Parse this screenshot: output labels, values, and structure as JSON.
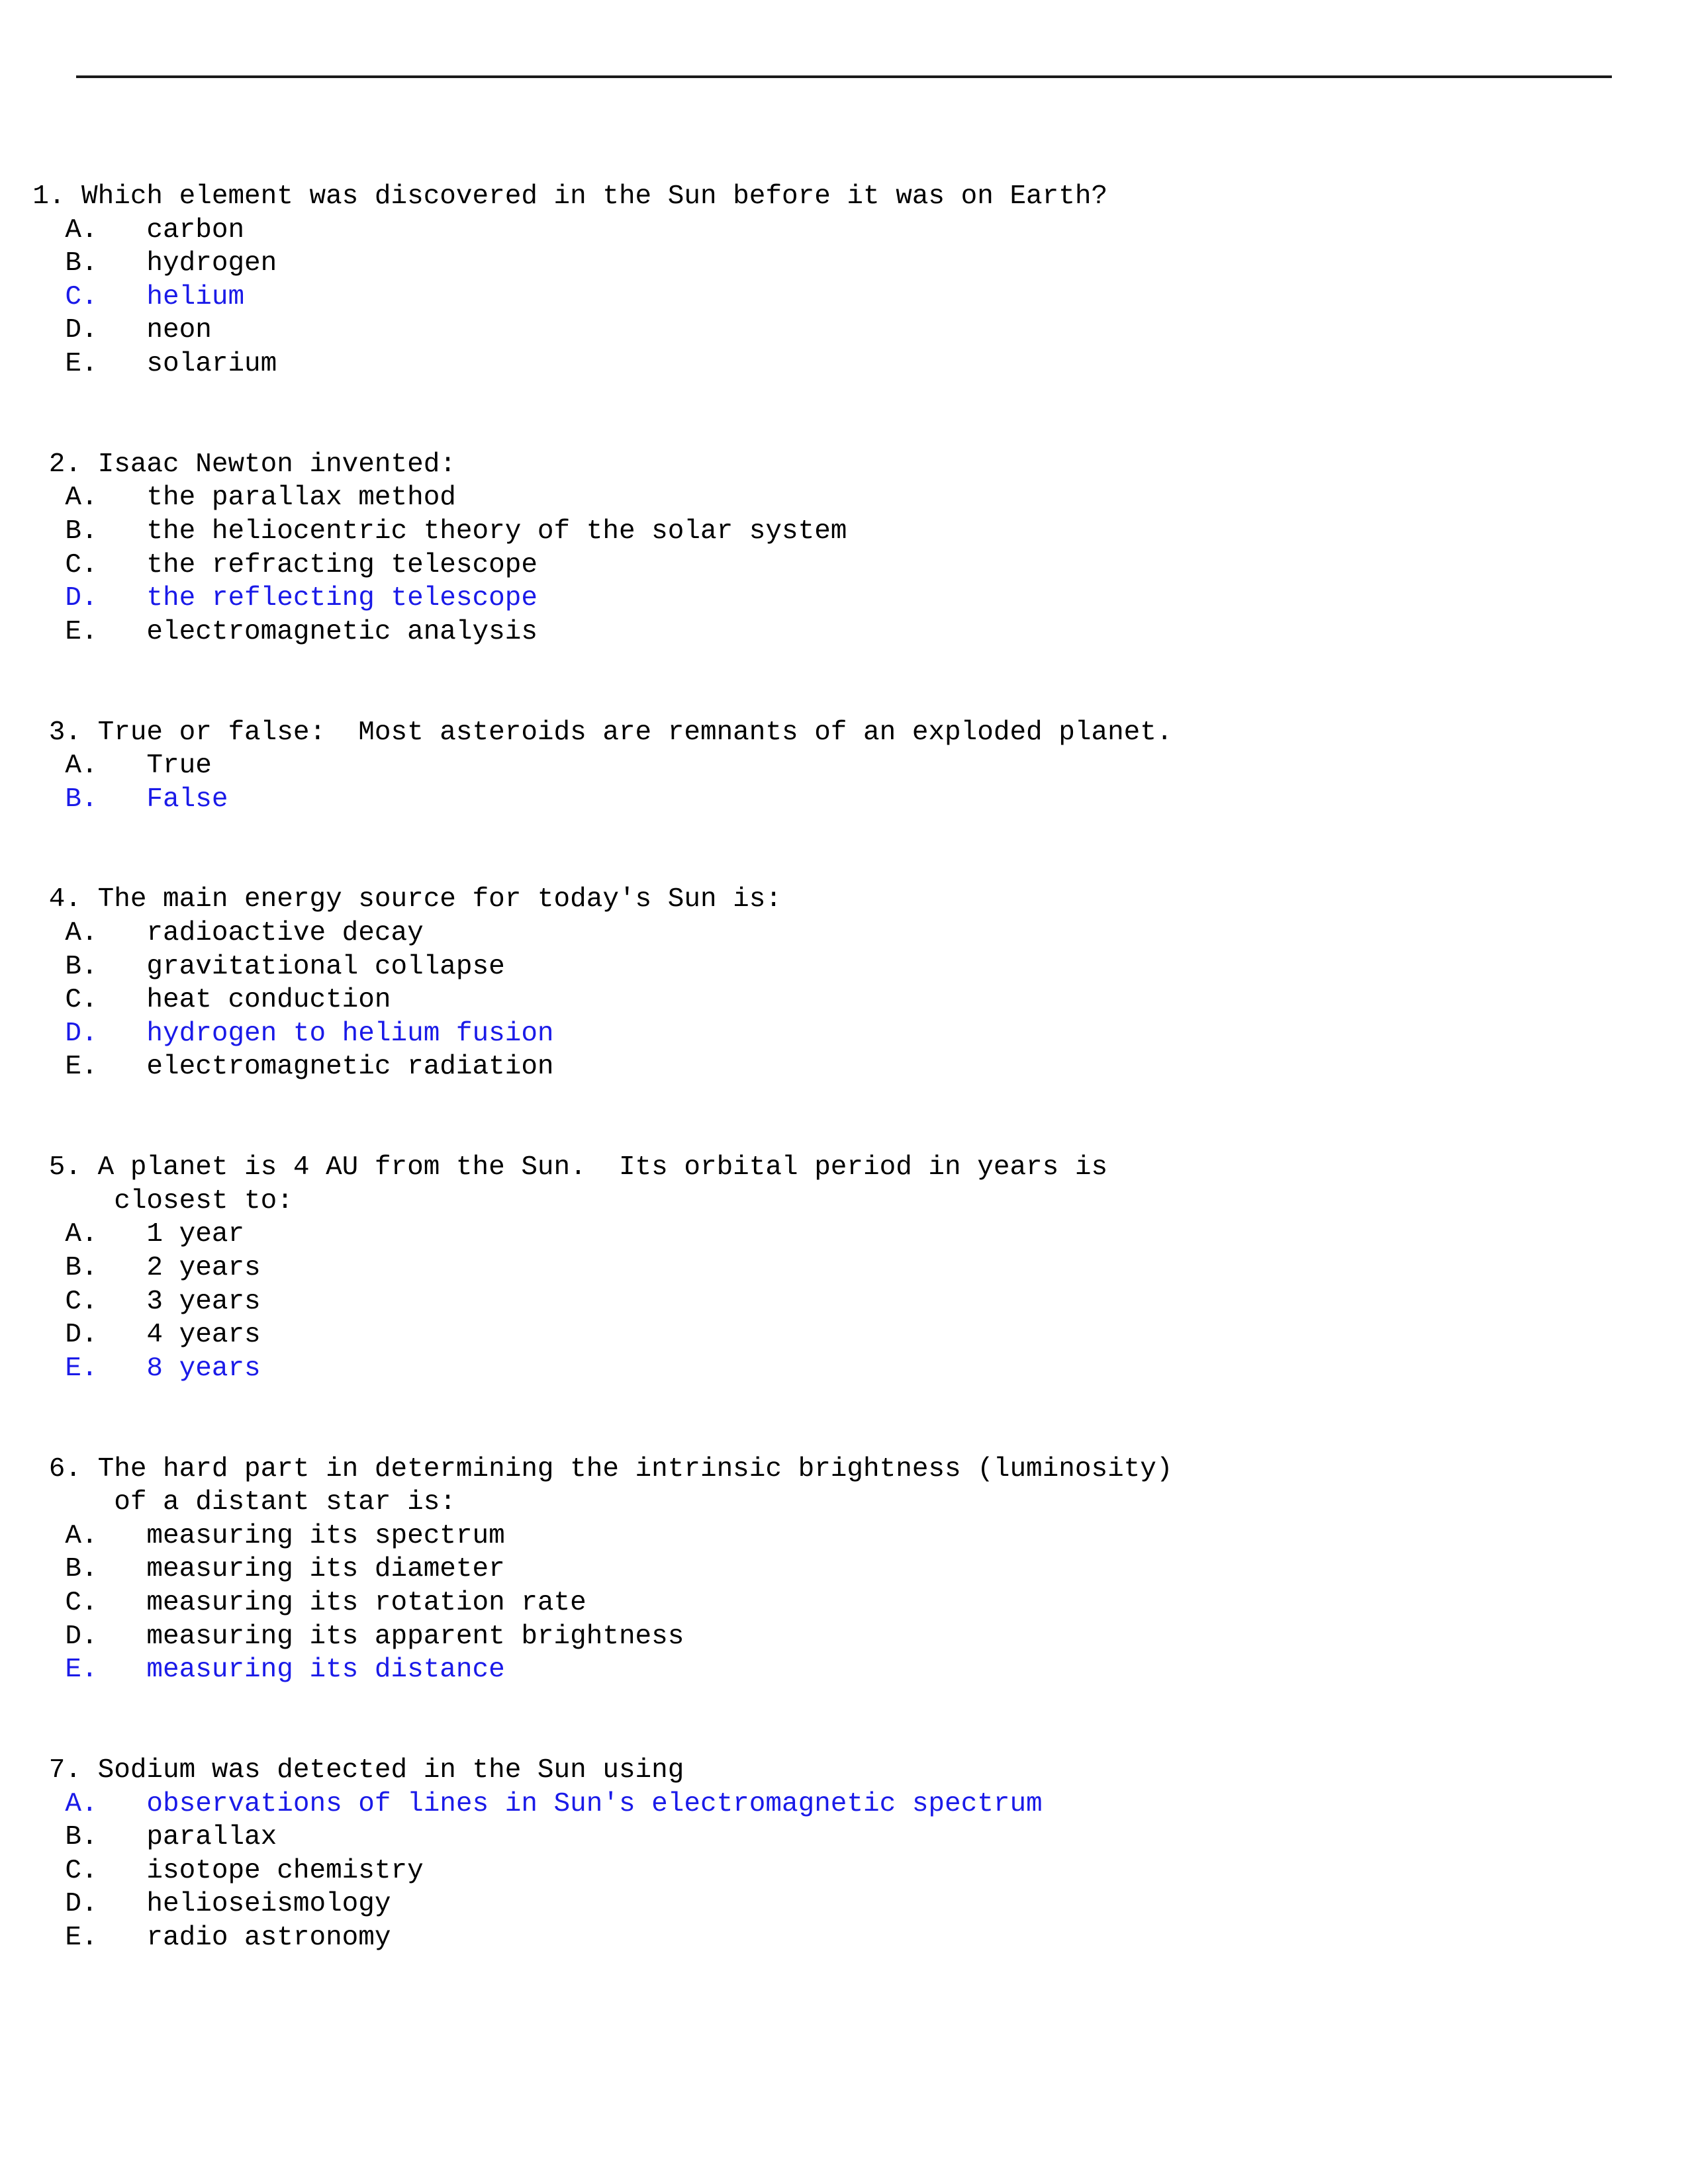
{
  "document": {
    "type": "multiple-choice-quiz",
    "subject": "astronomy",
    "answer_highlight_color": "#1a1ae8",
    "text_color": "#000000",
    "background_color": "#ffffff",
    "rule_color": "#1a1a1a"
  },
  "questions": [
    {
      "number": "1.",
      "number_indent": "  ",
      "stem_lines": [
        "Which element was discovered in the Sun before it was on Earth?"
      ],
      "option_indent": "    ",
      "options": [
        {
          "letter": "A.",
          "gap": "   ",
          "text": "carbon",
          "is_answer": false
        },
        {
          "letter": "B.",
          "gap": "   ",
          "text": "hydrogen",
          "is_answer": false
        },
        {
          "letter": "C.",
          "gap": "   ",
          "text": "helium",
          "is_answer": true
        },
        {
          "letter": "D.",
          "gap": "   ",
          "text": "neon",
          "is_answer": false
        },
        {
          "letter": "E.",
          "gap": "   ",
          "text": "solarium",
          "is_answer": false
        }
      ]
    },
    {
      "number": "2.",
      "number_indent": "   ",
      "stem_lines": [
        "Isaac Newton invented:"
      ],
      "option_indent": "    ",
      "options": [
        {
          "letter": "A.",
          "gap": "   ",
          "text": "the parallax method",
          "is_answer": false
        },
        {
          "letter": "B.",
          "gap": "   ",
          "text": "the heliocentric theory of the solar system",
          "is_answer": false
        },
        {
          "letter": "C.",
          "gap": "   ",
          "text": "the refracting telescope",
          "is_answer": false
        },
        {
          "letter": "D.",
          "gap": "   ",
          "text": "the reflecting telescope",
          "is_answer": true
        },
        {
          "letter": "E.",
          "gap": "   ",
          "text": "electromagnetic analysis",
          "is_answer": false
        }
      ]
    },
    {
      "number": "3.",
      "number_indent": "   ",
      "stem_lines": [
        "True or false:  Most asteroids are remnants of an exploded planet."
      ],
      "option_indent": "    ",
      "options": [
        {
          "letter": "A.",
          "gap": "   ",
          "text": "True",
          "is_answer": false
        },
        {
          "letter": "B.",
          "gap": "   ",
          "text": "False",
          "is_answer": true
        }
      ]
    },
    {
      "number": "4.",
      "number_indent": "   ",
      "stem_lines": [
        "The main energy source for today's Sun is:"
      ],
      "option_indent": "    ",
      "options": [
        {
          "letter": "A.",
          "gap": "   ",
          "text": "radioactive decay",
          "is_answer": false
        },
        {
          "letter": "B.",
          "gap": "   ",
          "text": "gravitational collapse",
          "is_answer": false
        },
        {
          "letter": "C.",
          "gap": "   ",
          "text": "heat conduction",
          "is_answer": false
        },
        {
          "letter": "D.",
          "gap": "   ",
          "text": "hydrogen to helium fusion",
          "is_answer": true
        },
        {
          "letter": "E.",
          "gap": "   ",
          "text": "electromagnetic radiation",
          "is_answer": false
        }
      ]
    },
    {
      "number": "5.",
      "number_indent": "   ",
      "stem_lines": [
        "A planet is 4 AU from the Sun.  Its orbital period in years is",
        "closest to:"
      ],
      "stem_continuation_indent": "       ",
      "option_indent": "    ",
      "options": [
        {
          "letter": "A.",
          "gap": "   ",
          "text": "1 year",
          "is_answer": false
        },
        {
          "letter": "B.",
          "gap": "   ",
          "text": "2 years",
          "is_answer": false
        },
        {
          "letter": "C.",
          "gap": "   ",
          "text": "3 years",
          "is_answer": false
        },
        {
          "letter": "D.",
          "gap": "   ",
          "text": "4 years",
          "is_answer": false
        },
        {
          "letter": "E.",
          "gap": "   ",
          "text": "8 years",
          "is_answer": true
        }
      ]
    },
    {
      "number": "6.",
      "number_indent": "   ",
      "stem_lines": [
        "The hard part in determining the intrinsic brightness (luminosity)",
        "of a distant star is:"
      ],
      "stem_continuation_indent": "       ",
      "option_indent": "    ",
      "options": [
        {
          "letter": "A.",
          "gap": "   ",
          "text": "measuring its spectrum",
          "is_answer": false
        },
        {
          "letter": "B.",
          "gap": "   ",
          "text": "measuring its diameter",
          "is_answer": false
        },
        {
          "letter": "C.",
          "gap": "   ",
          "text": "measuring its rotation rate",
          "is_answer": false
        },
        {
          "letter": "D.",
          "gap": "   ",
          "text": "measuring its apparent brightness",
          "is_answer": false
        },
        {
          "letter": "E.",
          "gap": "   ",
          "text": "measuring its distance",
          "is_answer": true
        }
      ]
    },
    {
      "number": "7.",
      "number_indent": "   ",
      "stem_lines": [
        "Sodium was detected in the Sun using"
      ],
      "option_indent": "    ",
      "options": [
        {
          "letter": "A.",
          "gap": "   ",
          "text": "observations of lines in Sun's electromagnetic spectrum",
          "is_answer": true
        },
        {
          "letter": "B.",
          "gap": "   ",
          "text": "parallax",
          "is_answer": false
        },
        {
          "letter": "C.",
          "gap": "   ",
          "text": "isotope chemistry",
          "is_answer": false
        },
        {
          "letter": "D.",
          "gap": "   ",
          "text": "helioseismology",
          "is_answer": false
        },
        {
          "letter": "E.",
          "gap": "   ",
          "text": "radio astronomy",
          "is_answer": false
        }
      ]
    }
  ]
}
